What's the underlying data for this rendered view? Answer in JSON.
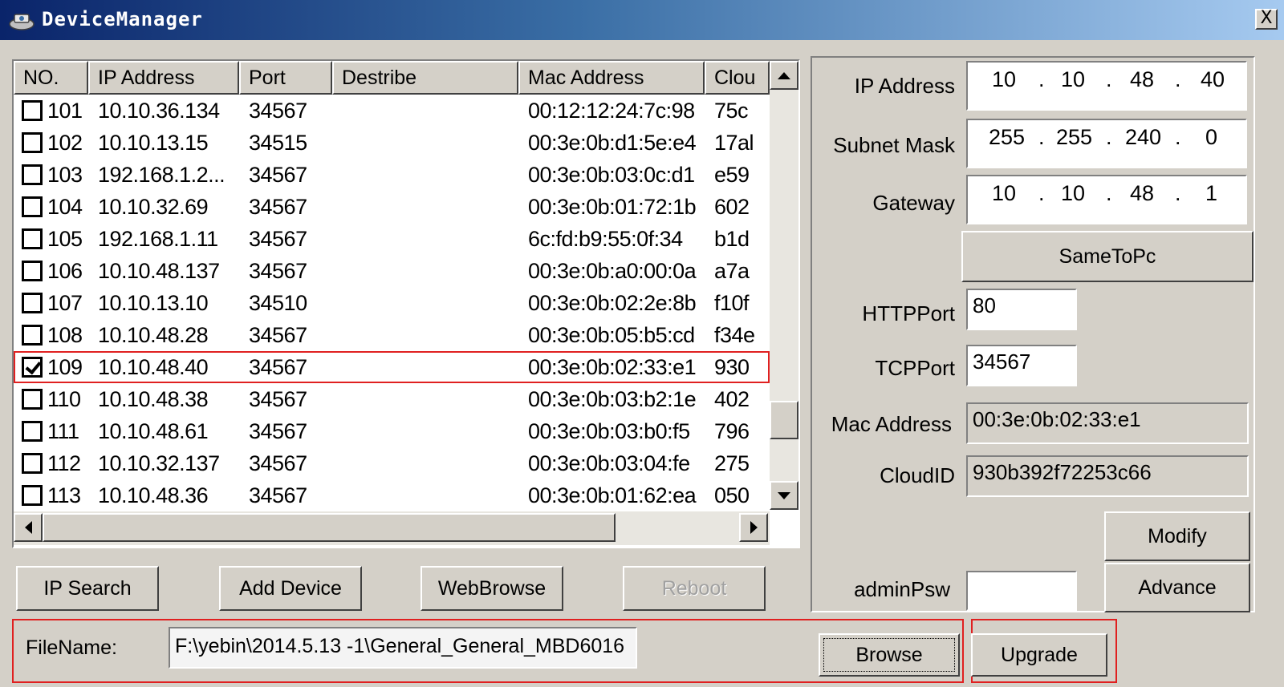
{
  "window": {
    "title": "DeviceManager",
    "close_label": "X"
  },
  "list": {
    "columns": [
      "NO.",
      "IP Address",
      "Port",
      "Destribe",
      "Mac Address",
      "Clou"
    ],
    "rows": [
      {
        "no": "101",
        "ip": "10.10.36.134",
        "port": "34567",
        "desc": "",
        "mac": "00:12:12:24:7c:98",
        "cloud": "75c",
        "checked": false
      },
      {
        "no": "102",
        "ip": "10.10.13.15",
        "port": "34515",
        "desc": "",
        "mac": "00:3e:0b:d1:5e:e4",
        "cloud": "17al",
        "checked": false
      },
      {
        "no": "103",
        "ip": "192.168.1.2...",
        "port": "34567",
        "desc": "",
        "mac": "00:3e:0b:03:0c:d1",
        "cloud": "e59",
        "checked": false
      },
      {
        "no": "104",
        "ip": "10.10.32.69",
        "port": "34567",
        "desc": "",
        "mac": "00:3e:0b:01:72:1b",
        "cloud": "602",
        "checked": false
      },
      {
        "no": "105",
        "ip": "192.168.1.11",
        "port": "34567",
        "desc": "",
        "mac": "6c:fd:b9:55:0f:34",
        "cloud": "b1d",
        "checked": false
      },
      {
        "no": "106",
        "ip": "10.10.48.137",
        "port": "34567",
        "desc": "",
        "mac": "00:3e:0b:a0:00:0a",
        "cloud": "a7a",
        "checked": false
      },
      {
        "no": "107",
        "ip": "10.10.13.10",
        "port": "34510",
        "desc": "",
        "mac": "00:3e:0b:02:2e:8b",
        "cloud": "f10f",
        "checked": false
      },
      {
        "no": "108",
        "ip": "10.10.48.28",
        "port": "34567",
        "desc": "",
        "mac": "00:3e:0b:05:b5:cd",
        "cloud": "f34e",
        "checked": false
      },
      {
        "no": "109",
        "ip": "10.10.48.40",
        "port": "34567",
        "desc": "",
        "mac": "00:3e:0b:02:33:e1",
        "cloud": "930",
        "checked": true
      },
      {
        "no": "110",
        "ip": "10.10.48.38",
        "port": "34567",
        "desc": "",
        "mac": "00:3e:0b:03:b2:1e",
        "cloud": "402",
        "checked": false
      },
      {
        "no": "111",
        "ip": "10.10.48.61",
        "port": "34567",
        "desc": "",
        "mac": "00:3e:0b:03:b0:f5",
        "cloud": "796",
        "checked": false
      },
      {
        "no": "112",
        "ip": "10.10.32.137",
        "port": "34567",
        "desc": "",
        "mac": "00:3e:0b:03:04:fe",
        "cloud": "275",
        "checked": false
      },
      {
        "no": "113",
        "ip": "10.10.48.36",
        "port": "34567",
        "desc": "",
        "mac": "00:3e:0b:01:62:ea",
        "cloud": "050",
        "checked": false
      }
    ],
    "selected_no": "109"
  },
  "buttons": {
    "ip_search": "IP Search",
    "add_device": "Add Device",
    "web_browse": "WebBrowse",
    "reboot": "Reboot"
  },
  "settings": {
    "ip_label": "IP Address",
    "ip": [
      "10",
      "10",
      "48",
      "40"
    ],
    "mask_label": "Subnet Mask",
    "mask": [
      "255",
      "255",
      "240",
      "0"
    ],
    "gateway_label": "Gateway",
    "gateway": [
      "10",
      "10",
      "48",
      "1"
    ],
    "same_to_pc": "SameToPc",
    "http_label": "HTTPPort",
    "http_port": "80",
    "tcp_label": "TCPPort",
    "tcp_port": "34567",
    "mac_label": "Mac Address",
    "mac": "00:3e:0b:02:33:e1",
    "cloud_label": "CloudID",
    "cloud_id": "930b392f72253c66",
    "modify": "Modify",
    "admin_label": "adminPsw",
    "admin_psw": "",
    "advance": "Advance",
    "dot": "."
  },
  "upgrade": {
    "file_label": "FileName:",
    "file_path": "F:\\yebin\\2014.5.13 -1\\General_General_MBD6016",
    "browse": "Browse",
    "upgrade": "Upgrade"
  },
  "colors": {
    "highlight_red": "#e02020",
    "face": "#d4d0c8",
    "title_start": "#0a246a"
  }
}
